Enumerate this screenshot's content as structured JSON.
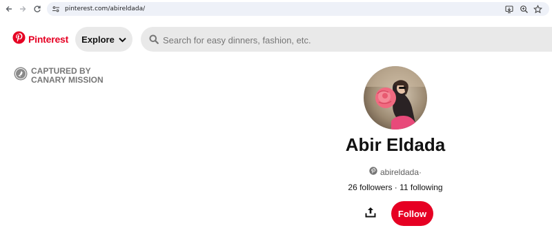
{
  "browser": {
    "url": "pinterest.com/abireldada/"
  },
  "header": {
    "logo_text": "Pinterest",
    "explore_label": "Explore",
    "search_placeholder": "Search for easy dinners, fashion, etc."
  },
  "watermark": {
    "line1": "CAPTURED BY",
    "line2": "CANARY MISSION"
  },
  "profile": {
    "name": "Abir Eldada",
    "username": "abireldada",
    "username_suffix": " ·",
    "stats": "26 followers · 11 following",
    "follow_label": "Follow"
  },
  "colors": {
    "brand": "#e60023",
    "pill_bg": "#e9e9e9",
    "muted_text": "#777777"
  },
  "icons": [
    "back-arrow-icon",
    "forward-arrow-icon",
    "reload-icon",
    "site-settings-icon",
    "install-app-icon",
    "zoom-icon",
    "star-icon",
    "pinterest-logo-icon",
    "chevron-down-icon",
    "search-icon",
    "canary-mission-icon",
    "pinterest-small-icon",
    "share-icon"
  ]
}
